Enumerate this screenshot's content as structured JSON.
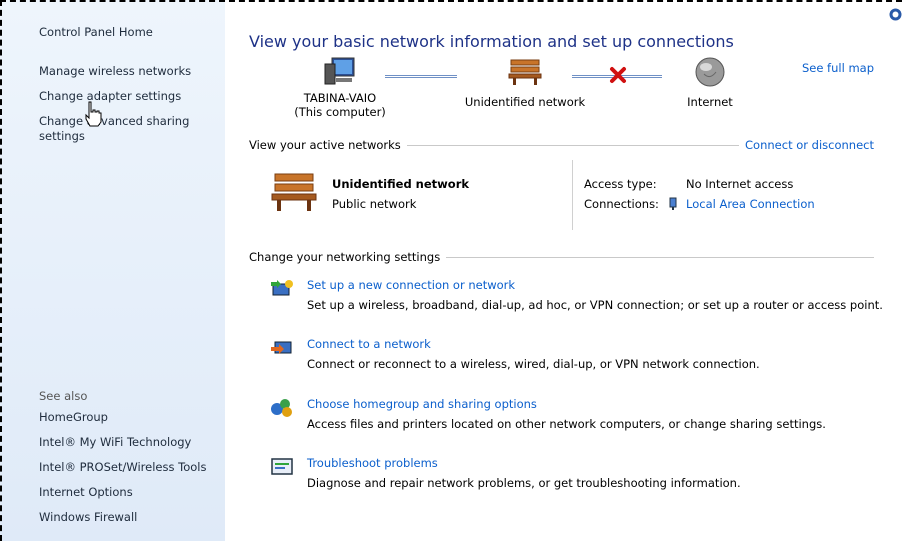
{
  "sidebar": {
    "home": "Control Panel Home",
    "tasks": [
      "Manage wireless networks",
      "Change adapter settings",
      "Change advanced sharing settings"
    ],
    "see_also_label": "See also",
    "see_also": [
      "HomeGroup",
      "Intel® My WiFi Technology",
      "Intel® PROSet/Wireless Tools",
      "Internet Options",
      "Windows Firewall"
    ]
  },
  "main": {
    "title": "View your basic network information and set up connections",
    "see_full_map": "See full map",
    "map": {
      "computer_name": "TABINA-VAIO",
      "computer_sub": "(This computer)",
      "network": "Unidentified network",
      "internet": "Internet"
    },
    "active_networks": {
      "header": "View your active networks",
      "action": "Connect or disconnect",
      "name": "Unidentified network",
      "type": "Public network",
      "access_label": "Access type:",
      "access_value": "No Internet access",
      "connections_label": "Connections:",
      "connections_value": "Local Area Connection"
    },
    "settings": {
      "header": "Change your networking settings",
      "tasks": [
        {
          "link": "Set up a new connection or network",
          "desc": "Set up a wireless, broadband, dial-up, ad hoc, or VPN connection; or set up a router or access point.",
          "icon": "new-connection-icon"
        },
        {
          "link": "Connect to a network",
          "desc": "Connect or reconnect to a wireless, wired, dial-up, or VPN network connection.",
          "icon": "connect-network-icon"
        },
        {
          "link": "Choose homegroup and sharing options",
          "desc": "Access files and printers located on other network computers, or change sharing settings.",
          "icon": "homegroup-icon"
        },
        {
          "link": "Troubleshoot problems",
          "desc": "Diagnose and repair network problems, or get troubleshooting information.",
          "icon": "troubleshoot-icon"
        }
      ]
    }
  },
  "colors": {
    "title": "#1e3287",
    "link": "#0b5fcc",
    "sidebar_bg": "#e6eff9",
    "error_x": "#d01010"
  }
}
